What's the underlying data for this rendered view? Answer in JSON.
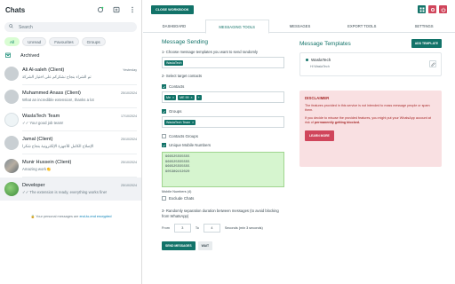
{
  "left": {
    "title": "Chats",
    "search_placeholder": "Search",
    "filters": [
      "All",
      "Unread",
      "Favourites",
      "Groups"
    ],
    "archived": "Archived",
    "chats": [
      {
        "name": "Ali Al-saleh (Client)",
        "time": "Yesterday",
        "msg": "تم الشراء بنجاح نشكركم على اختيار الشركة",
        "avatar": "default"
      },
      {
        "name": "Muhammed Anass (Client)",
        "time": "25/10/2024",
        "msg": "What an incredible extension!, thanks a lot",
        "avatar": "default"
      },
      {
        "name": "WaslaTech Team",
        "time": "17/10/2024",
        "msg": "✓✓ You! good job team!",
        "avatar": "logo"
      },
      {
        "name": "Jamal (Client)",
        "time": "25/10/2024",
        "msg": "الإصلاح الكامل للأجهزة الإلكترونية بنجاح شكرا",
        "avatar": "default"
      },
      {
        "name": "Munir Hussein (Client)",
        "time": "25/10/2024",
        "msg": "Amazing work👏",
        "avatar": "photo"
      },
      {
        "name": "Developer",
        "time": "25/10/2024",
        "msg": "✓✓ The extension is ready, everything works fine!",
        "avatar": "green"
      }
    ],
    "encrypted_prefix": "Your personal messages are ",
    "encrypted_link": "end-to-end encrypted"
  },
  "right": {
    "close_label": "CLOSE WORKBOOK",
    "tabs": [
      "DASHBOARD",
      "MESSAGING TOOLS",
      "MESSAGES",
      "EXPORT TOOLS",
      "SETTINGS"
    ],
    "active_tab": 1,
    "colors": {
      "accent": "#127369",
      "danger": "#d0455b"
    },
    "sending": {
      "title": "Message Sending",
      "step1": "1- Choose message templates you want to send randomly",
      "template_tag": "WaslaTech",
      "step2": "2- Select target contacts",
      "contacts_label": "Contacts",
      "contact_tags": [
        "Me",
        "ME 99",
        "+"
      ],
      "groups_label": "Groups",
      "group_tags": [
        "WaslaTech Team"
      ],
      "contacts_groups_label": "Contacts Groups",
      "unique_label": "Unique Mobile Numbers",
      "numbers": [
        "966525555555",
        "966525555555",
        "966525555555",
        "905389152020"
      ],
      "numbers_count": "Mobile Numbers (4)",
      "exclude_label": "Exclude Chats",
      "step3": "3- Randomly separation duration between messages (to avoid blocking from WhatsApp)",
      "from_label": "From",
      "from_value": "3",
      "to_label": "To",
      "to_value": "4",
      "seconds_label": "Seconds (min 3 seconds)",
      "send_label": "SEND MESSAGES",
      "wait_label": "WAIT"
    },
    "templates": {
      "title": "Message Templates",
      "add_label": "ADD TEMPLATE",
      "card_name": "WaslaTech",
      "card_msg": "Hi WaslaTech",
      "disclaimer_title": "DISCLAIMER",
      "disclaimer_p1": "The features provided in this service is not intended to mass message people or spam them.",
      "disclaimer_p2_a": "If you decide to misuse the provided features, you might put your WhatsApp account at risk of ",
      "disclaimer_p2_b": "permanently getting blocked.",
      "learn_more": "LEARN MORE"
    }
  }
}
